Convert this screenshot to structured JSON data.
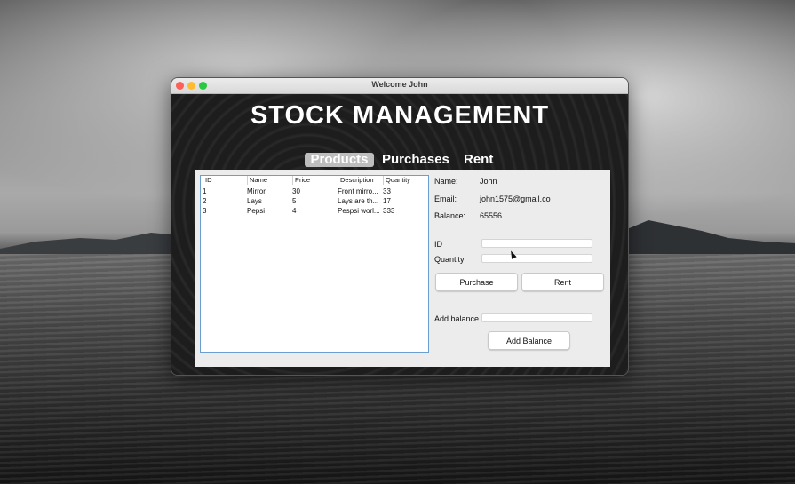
{
  "window": {
    "title": "Welcome John"
  },
  "app": {
    "heading": "STOCK MANAGEMENT"
  },
  "tabs": [
    {
      "label": "Products",
      "active": true
    },
    {
      "label": "Purchases",
      "active": false
    },
    {
      "label": "Rent",
      "active": false
    }
  ],
  "table": {
    "columns": [
      "ID",
      "Name",
      "Price",
      "Description",
      "Quantity"
    ],
    "rows": [
      [
        "1",
        "Mirror",
        "30",
        "Front mirro...",
        "33"
      ],
      [
        "2",
        "Lays",
        "5",
        "Lays are th...",
        "17"
      ],
      [
        "3",
        "Pepsi",
        "4",
        "Pespsi worl...",
        "333"
      ]
    ]
  },
  "user": {
    "name_label": "Name:",
    "name_value": "John",
    "email_label": "Email:",
    "email_value": "john1575@gmail.co",
    "balance_label": "Balance:",
    "balance_value": "65556"
  },
  "form": {
    "id_label": "ID",
    "id_value": "",
    "quantity_label": "Quantity",
    "quantity_value": "",
    "purchase_button": "Purchase",
    "rent_button": "Rent",
    "add_balance_label": "Add balance",
    "add_balance_value": "",
    "add_balance_button": "Add Balance"
  },
  "colors": {
    "close": "#fe5f57",
    "minimize": "#febc2e",
    "maximize": "#28c840",
    "table_border": "#6b9fd0",
    "active_tab_bg": "#bdbdbd"
  }
}
